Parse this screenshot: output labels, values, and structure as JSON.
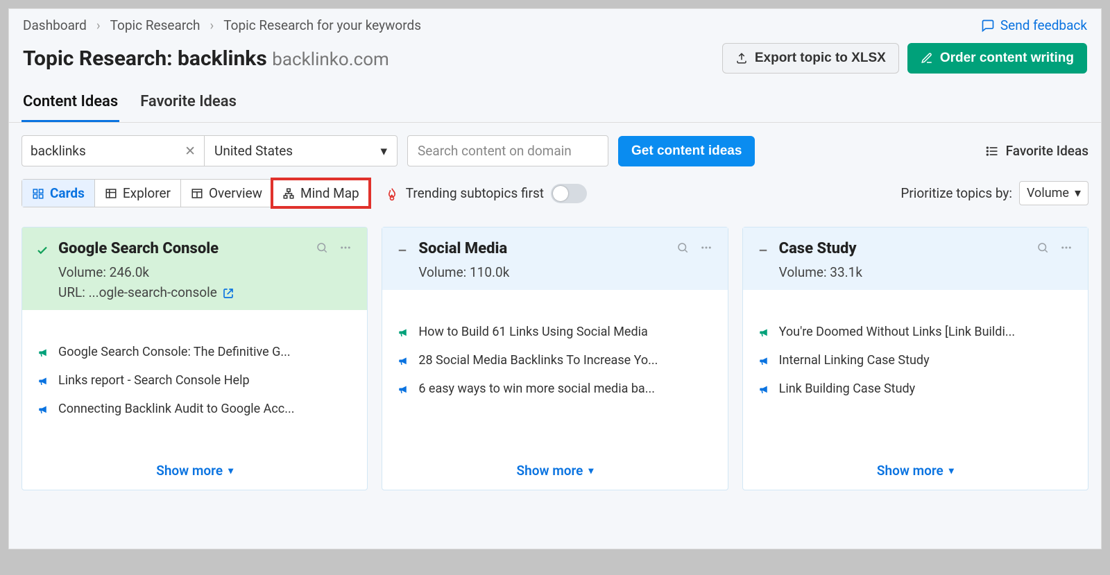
{
  "breadcrumb": {
    "items": [
      "Dashboard",
      "Topic Research",
      "Topic Research for your keywords"
    ]
  },
  "feedback_label": "Send feedback",
  "title": {
    "prefix": "Topic Research: ",
    "keyword": "backlinks",
    "domain": "backlinko.com"
  },
  "actions": {
    "export_label": "Export topic to XLSX",
    "order_label": "Order content writing"
  },
  "page_tabs": {
    "content_ideas": "Content Ideas",
    "favorite_ideas": "Favorite Ideas",
    "active": "content_ideas"
  },
  "controls": {
    "keyword_value": "backlinks",
    "region_value": "United States",
    "domain_placeholder": "Search content on domain",
    "get_ideas_label": "Get content ideas",
    "favorite_ideas_link": "Favorite Ideas"
  },
  "view_seg": {
    "cards": "Cards",
    "explorer": "Explorer",
    "overview": "Overview",
    "mindmap": "Mind Map",
    "active": "cards",
    "highlighted": "mindmap"
  },
  "trending_label": "Trending subtopics first",
  "prioritize": {
    "label": "Prioritize topics by:",
    "value": "Volume"
  },
  "cards": [
    {
      "favorited": true,
      "title": "Google Search Console",
      "volume_label": "Volume: 246.0k",
      "url_label": "URL: ...ogle-search-console",
      "ideas": [
        {
          "color": "green",
          "text": "Google Search Console: The Definitive G..."
        },
        {
          "color": "blue",
          "text": "Links report - Search Console Help"
        },
        {
          "color": "blue",
          "text": "Connecting Backlink Audit to Google Acc..."
        }
      ],
      "show_more": "Show more"
    },
    {
      "favorited": false,
      "title": "Social Media",
      "volume_label": "Volume: 110.0k",
      "url_label": "",
      "ideas": [
        {
          "color": "green",
          "text": "How to Build 61 Links Using Social Media"
        },
        {
          "color": "blue",
          "text": "28 Social Media Backlinks To Increase Yo..."
        },
        {
          "color": "blue",
          "text": "6 easy ways to win more social media ba..."
        }
      ],
      "show_more": "Show more"
    },
    {
      "favorited": false,
      "title": "Case Study",
      "volume_label": "Volume: 33.1k",
      "url_label": "",
      "ideas": [
        {
          "color": "green",
          "text": "You're Doomed Without Links [Link Buildi..."
        },
        {
          "color": "blue",
          "text": "Internal Linking Case Study"
        },
        {
          "color": "blue",
          "text": "Link Building Case Study"
        }
      ],
      "show_more": "Show more"
    }
  ]
}
